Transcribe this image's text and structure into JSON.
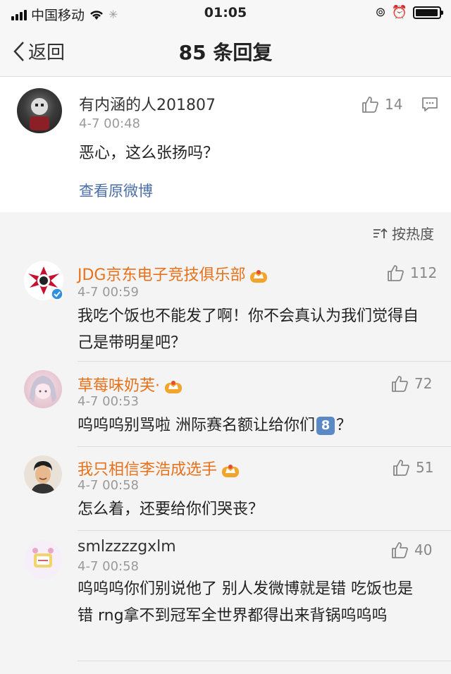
{
  "status_bar": {
    "carrier": "中国移动",
    "time": "01:05"
  },
  "nav": {
    "back_label": "返回",
    "title": "85 条回复"
  },
  "main_post": {
    "username": "有内涵的人201807",
    "time": "4-7 00:48",
    "text": "恶心，这么张扬吗？",
    "likes": "14",
    "view_original": "查看原微博"
  },
  "sort": {
    "label": "按热度"
  },
  "replies": [
    {
      "username": "JDG京东电子竞技俱乐部",
      "time": "4-7 00:59",
      "text": "我吃个饭也不能发了啊！你不会真认为我们觉得自己是带明星吧？",
      "likes": "112"
    },
    {
      "username": "草莓味奶芙·",
      "time": "4-7 00:53",
      "text": "呜呜呜别骂啦 洲际赛名额让给你们",
      "emoji": "8",
      "text_after": "？",
      "likes": "72"
    },
    {
      "username": "我只相信李浩成选手",
      "time": "4-7 00:58",
      "text": "怎么着，还要给你们哭丧？",
      "likes": "51"
    },
    {
      "username": "smlzzzzgxlm",
      "time": "4-7 00:58",
      "text": "呜呜呜你们别说他了 别人发微博就是错 吃饭也是错 rng拿不到冠军全世界都得出来背锅呜呜呜",
      "likes": "40"
    }
  ],
  "colors": {
    "link": "#4a6ea8",
    "vip_name": "#e8711a",
    "muted": "#9a9a9a"
  }
}
